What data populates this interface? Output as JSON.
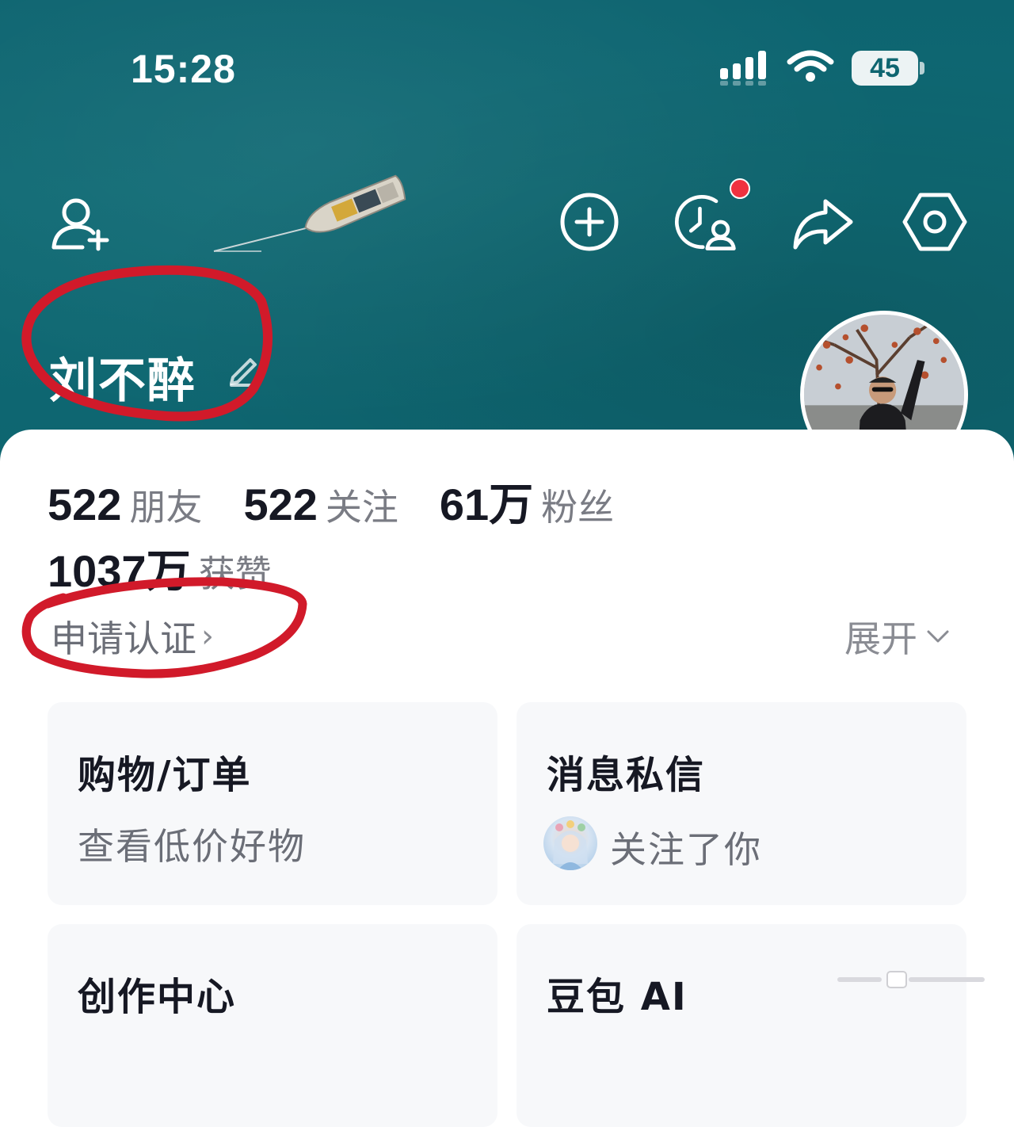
{
  "status_bar": {
    "time": "15:28",
    "battery": "45"
  },
  "toolbar": {
    "add_friend_icon": "add-friend-icon",
    "create_icon": "plus-circle-icon",
    "visitors_icon": "recent-visitors-icon",
    "share_icon": "share-icon",
    "settings_icon": "settings-hexagon-icon",
    "notification_color": "#f0313f"
  },
  "profile": {
    "name": "刘不醉"
  },
  "stats": [
    {
      "value": "522",
      "label": "朋友"
    },
    {
      "value": "522",
      "label": "关注"
    },
    {
      "value": "61万",
      "label": "粉丝"
    }
  ],
  "likes": {
    "value": "1037万",
    "label": "获赞"
  },
  "verify_link": "申请认证",
  "expand_label": "展开",
  "tiles": [
    {
      "title": "购物/订单",
      "subtitle": "查看低价好物"
    },
    {
      "title": "消息私信",
      "subtitle": "关注了你"
    },
    {
      "title": "创作中心"
    },
    {
      "title": "豆包 AI"
    }
  ],
  "colors": {
    "header": "#0e6570",
    "annotation": "#d11a2a",
    "text_primary": "#161823",
    "text_secondary": "#6b6e77"
  }
}
